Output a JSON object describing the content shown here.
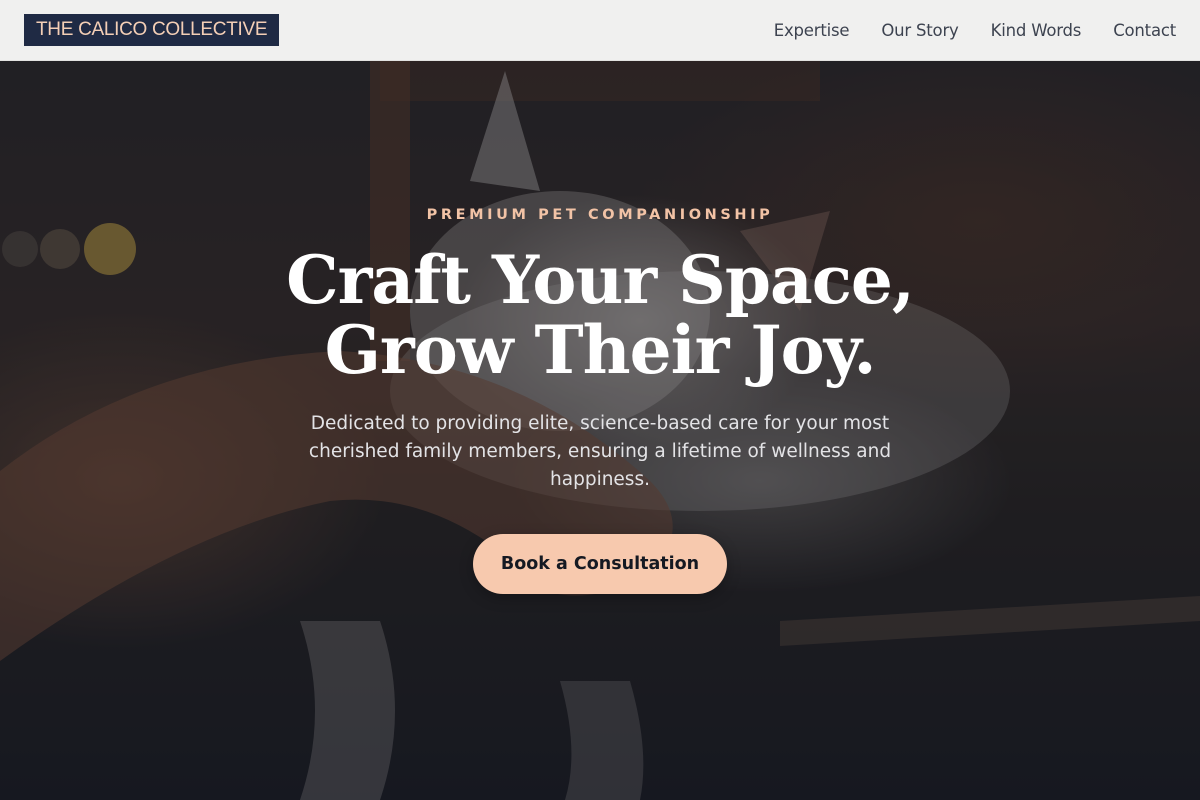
{
  "header": {
    "logo_text": "THE CALICO COLLECTIVE",
    "nav": [
      {
        "label": "Expertise"
      },
      {
        "label": "Our Story"
      },
      {
        "label": "Kind Words"
      },
      {
        "label": "Contact"
      }
    ]
  },
  "hero": {
    "eyebrow": "PREMIUM PET COMPANIONSHIP",
    "headline_line1": "Craft Your Space,",
    "headline_line2": "Grow Their Joy.",
    "description": "Dedicated to providing elite, science-based care for your most cherished family members, ensuring a lifetime of wellness and happiness.",
    "cta_label": "Book a Consultation",
    "background_image": "cat-being-petted-photo"
  },
  "colors": {
    "logo_bg": "#1f2a44",
    "logo_text": "#f4cfb6",
    "accent": "#f7c9ae",
    "eyebrow": "#f2c3a6",
    "header_bg": "#f0f0ef"
  }
}
